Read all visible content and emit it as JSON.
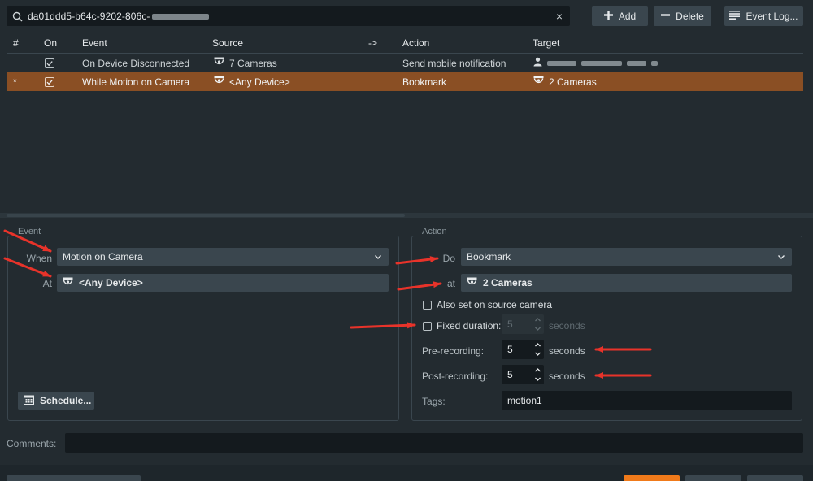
{
  "search": {
    "value_prefix": "da01ddd5-b64c-9202-806c-",
    "clear_glyph": "×"
  },
  "toolbar": {
    "add_label": "Add",
    "delete_label": "Delete",
    "event_log_label": "Event Log..."
  },
  "table": {
    "headers": {
      "num": "#",
      "on": "On",
      "event": "Event",
      "source": "Source",
      "arrow": "->",
      "action": "Action",
      "target": "Target"
    },
    "rows": [
      {
        "num": "",
        "on": true,
        "event": "On Device Disconnected",
        "source": "7 Cameras",
        "action": "Send mobile notification",
        "target": ""
      },
      {
        "num": "*",
        "on": true,
        "event": "While Motion on Camera",
        "source": "<Any Device>",
        "action": "Bookmark",
        "target": "2 Cameras"
      }
    ]
  },
  "event_panel": {
    "title": "Event",
    "when_label": "When",
    "when_value": "Motion on Camera",
    "at_label": "At",
    "at_value": "<Any Device>",
    "schedule_label": "Schedule..."
  },
  "action_panel": {
    "title": "Action",
    "do_label": "Do",
    "do_value": "Bookmark",
    "at_label": "at",
    "at_value": "2 Cameras",
    "also_source_label": "Also set on source camera",
    "fixed_duration_label": "Fixed duration:",
    "fixed_duration_value": "5",
    "fixed_duration_unit": "seconds",
    "pre_recording_label": "Pre-recording:",
    "pre_recording_value": "5",
    "pre_recording_unit": "seconds",
    "post_recording_label": "Post-recording:",
    "post_recording_value": "5",
    "post_recording_unit": "seconds",
    "tags_label": "Tags:",
    "tags_value": "motion1"
  },
  "comments": {
    "label": "Comments:",
    "value": ""
  },
  "colors": {
    "background": "#232b30",
    "selected_row": "#8a4f24",
    "field": "#3a464e",
    "input_dark": "#141a1e",
    "annotation_arrow": "#e8332a",
    "primary_button": "#f07a1a"
  }
}
